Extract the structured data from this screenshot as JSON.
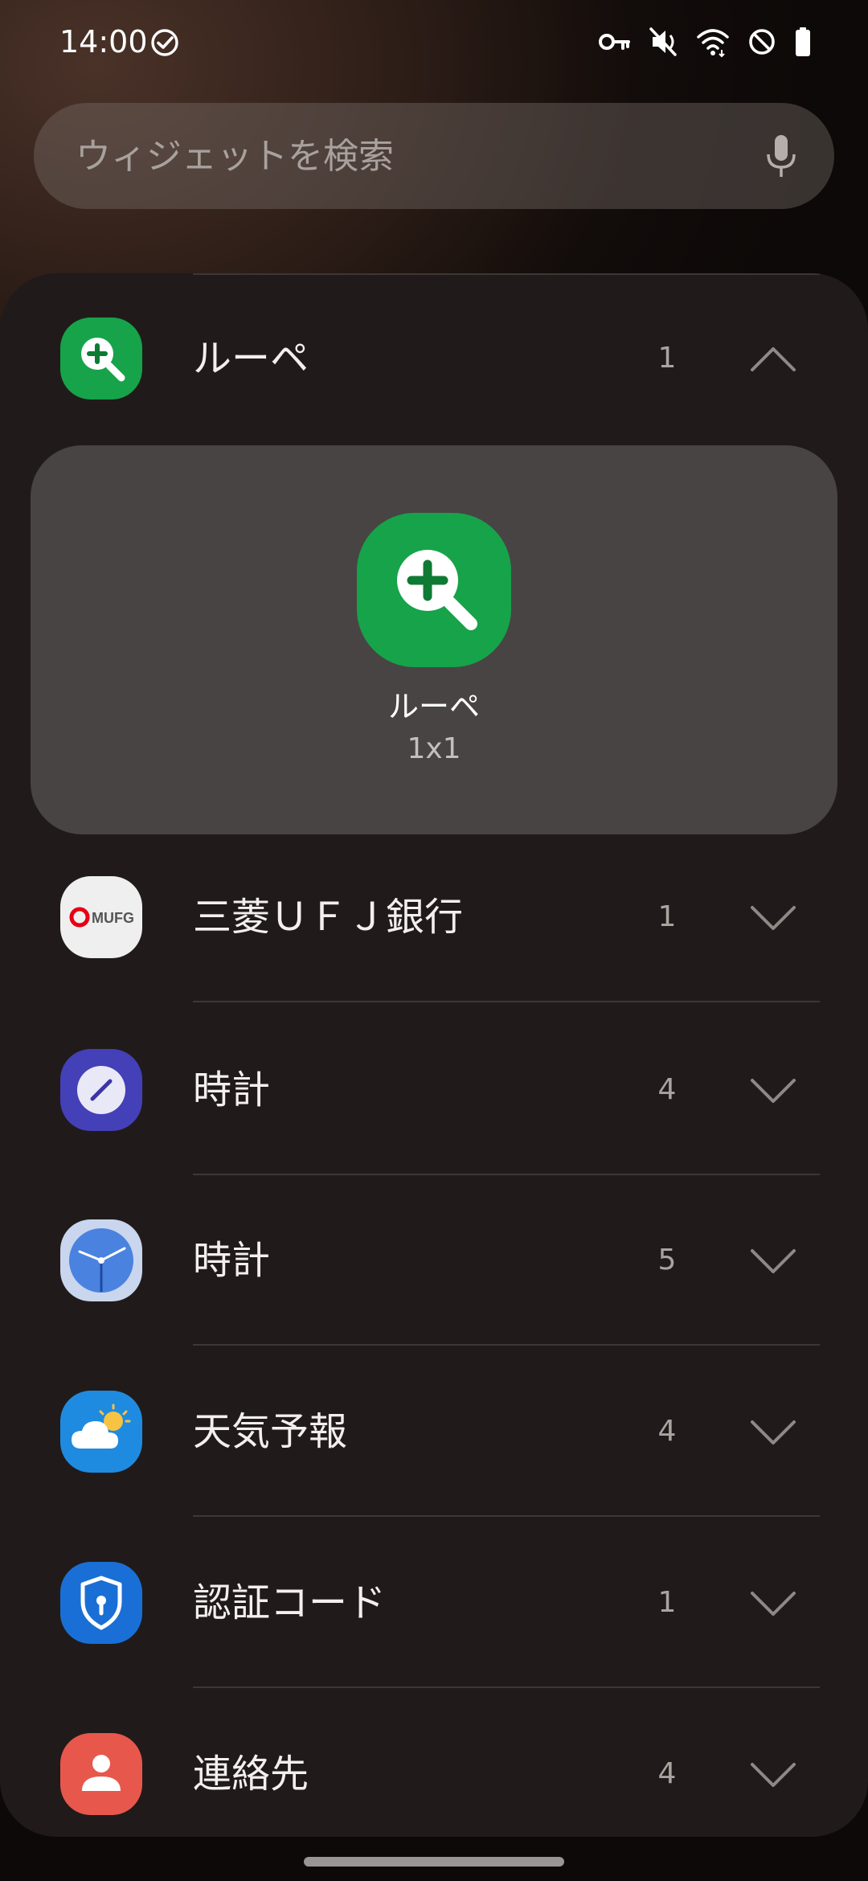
{
  "status_bar": {
    "time": "14:00",
    "icons": [
      "check-circle-icon",
      "key-icon",
      "mute-icon",
      "wifi-6-icon",
      "do-not-disturb-icon",
      "battery-icon"
    ]
  },
  "search": {
    "placeholder": "ウィジェットを検索",
    "value": ""
  },
  "widgets": [
    {
      "label": "ルーペ",
      "count": "1",
      "expanded": true,
      "icon": "magnifier-plus-icon",
      "icon_bg": "#16a34a"
    },
    {
      "label": "三菱ＵＦＪ銀行",
      "count": "1",
      "expanded": false,
      "icon": "mufg-logo-icon",
      "icon_bg": "#efefef",
      "icon_text": "MUFG"
    },
    {
      "label": "時計",
      "count": "4",
      "expanded": false,
      "icon": "compass-clock-icon",
      "icon_bg": "#4440b8"
    },
    {
      "label": "時計",
      "count": "5",
      "expanded": false,
      "icon": "analog-clock-icon",
      "icon_bg": "#c9d6ee"
    },
    {
      "label": "天気予報",
      "count": "4",
      "expanded": false,
      "icon": "weather-cloud-sun-icon",
      "icon_bg": "#1f8be0"
    },
    {
      "label": "認証コード",
      "count": "1",
      "expanded": false,
      "icon": "shield-lock-icon",
      "icon_bg": "#1a6fd6"
    },
    {
      "label": "連絡先",
      "count": "4",
      "expanded": false,
      "icon": "person-icon",
      "icon_bg": "#e8574c"
    }
  ],
  "preview": {
    "name": "ルーペ",
    "size": "1x1",
    "icon": "magnifier-plus-icon"
  },
  "colors": {
    "panel": "#201b1a",
    "card": "#484443",
    "divider": "#3d3735",
    "muted_text": "#aaa4a1"
  }
}
